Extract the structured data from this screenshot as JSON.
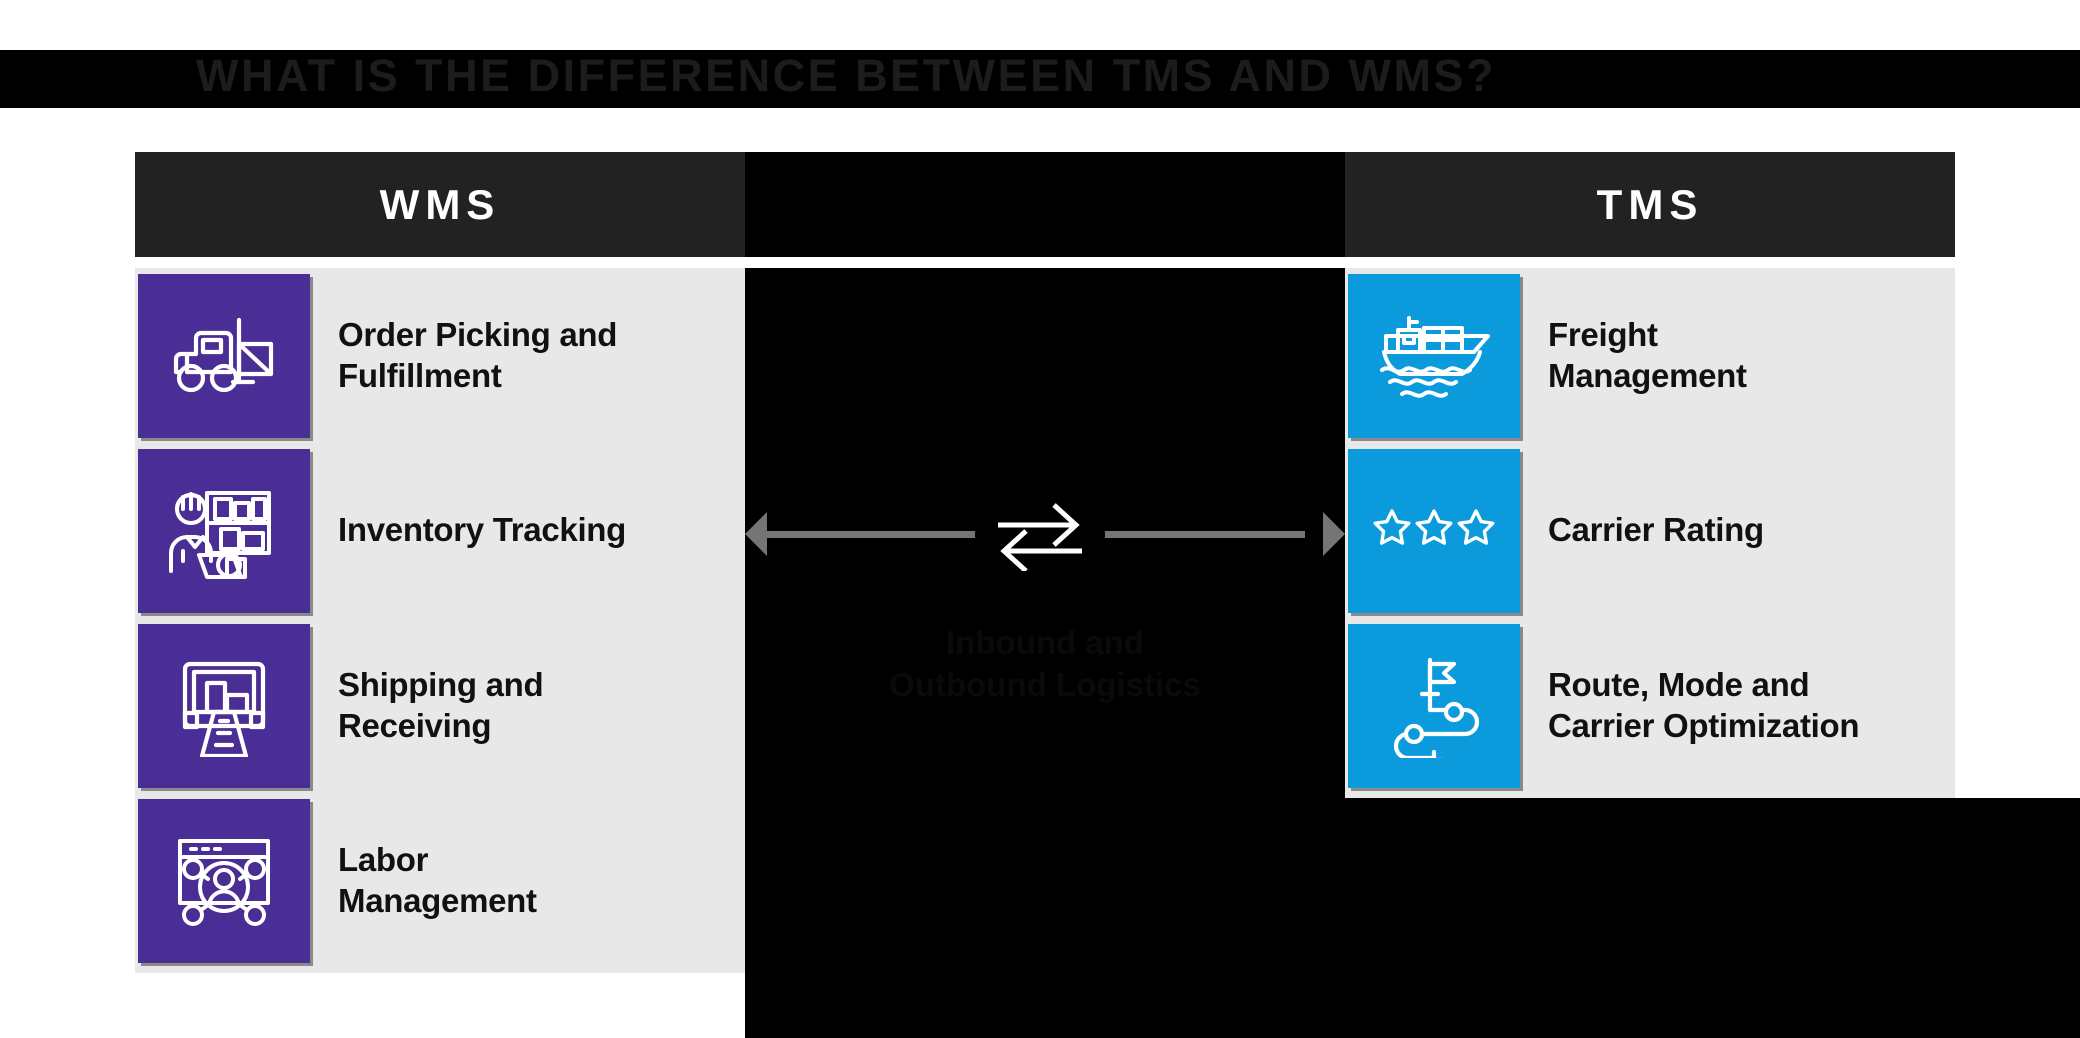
{
  "title": "WHAT IS THE DIFFERENCE BETWEEN TMS AND WMS?",
  "columns": {
    "left_header": "WMS",
    "middle_header": "",
    "right_header": "TMS"
  },
  "middle": {
    "caption_line1": "Inbound and",
    "caption_line2": "Outbound Logistics",
    "icon": "exchange-arrows-icon"
  },
  "colors": {
    "wms_tile": "#4B2D96",
    "tms_tile": "#0B9BDD",
    "header_bar": "#222222",
    "panel_bg": "#E8E8E8",
    "middle_bg": "#000000",
    "connector": "#757575"
  },
  "wms_rows": [
    {
      "icon": "forklift-icon",
      "label_line1": "Order Picking and",
      "label_line2": "Fulfillment"
    },
    {
      "icon": "inventory-worker-icon",
      "label_line1": "Inventory Tracking",
      "label_line2": ""
    },
    {
      "icon": "loading-dock-icon",
      "label_line1": "Shipping and",
      "label_line2": "Receiving"
    },
    {
      "icon": "labor-network-icon",
      "label_line1": "Labor",
      "label_line2": "Management"
    }
  ],
  "tms_rows": [
    {
      "icon": "cargo-ship-icon",
      "label_line1": "Freight",
      "label_line2": "Management"
    },
    {
      "icon": "three-stars-icon",
      "label_line1": "Carrier Rating",
      "label_line2": ""
    },
    {
      "icon": "route-flag-icon",
      "label_line1": "Route, Mode and",
      "label_line2": "Carrier Optimization"
    }
  ]
}
